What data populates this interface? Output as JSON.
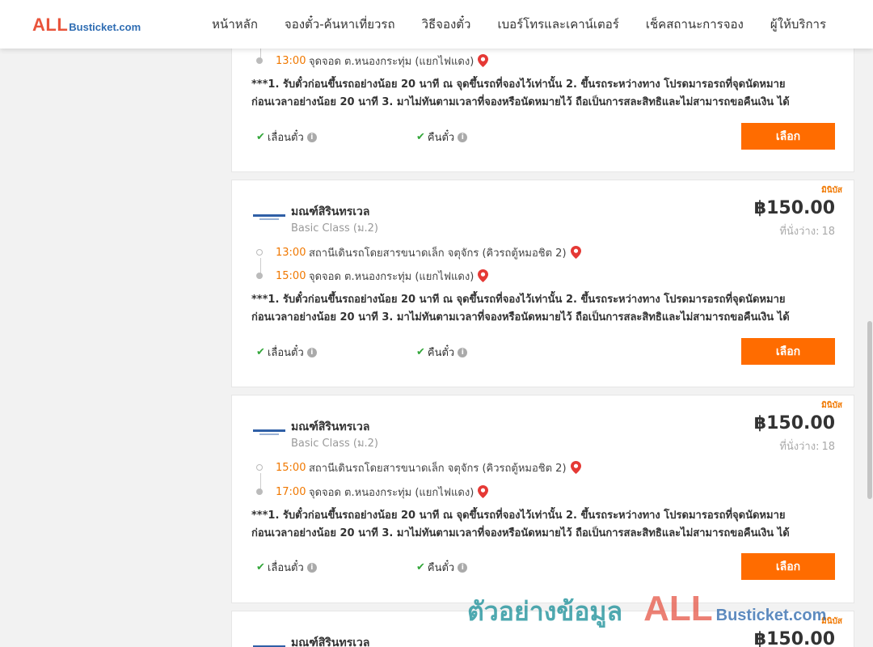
{
  "header": {
    "logo_all": "ALL",
    "logo_rest": "Busticket.com",
    "nav": [
      "หน้าหลัก",
      "จองตั๋ว-ค้นหาเที่ยวรถ",
      "วิธีจองตั๋ว",
      "เบอร์โทรและเคาน์เตอร์",
      "เช็คสถานะการจอง",
      "ผู้ให้บริการ"
    ]
  },
  "cards": [
    {
      "arrive_time": "13:00",
      "arrive_place": "จุดจอด ต.หนองกระทุ่ม (แยกไฟแดง)",
      "note1": "***1. รับตั๋วก่อนขึ้นรถอย่างน้อย 20 นาที ณ จุดขึ้นรถที่จองไว้เท่านั้น 2. ขึ้นรถระหว่างทาง โปรดมารอรถที่จุดนัดหมาย",
      "note2": "ก่อนเวลาอย่างน้อย 20 นาที 3. มาไม่ทันตามเวลาที่จองหรือนัดหมายไว้ ถือเป็นการสละสิทธิและไม่สามารถขอคืนเงิน ได้",
      "feature1": "เลื่อนตั๋ว",
      "feature2": "คืนตั๋ว",
      "button": "เลือก"
    },
    {
      "badge": "มินิบัส",
      "operator": "มณฑ์สิรินทรเวล",
      "class": "Basic Class (ม.2)",
      "price": "฿150.00",
      "seats_label": "ที่นั่งว่าง:",
      "seats": "18",
      "depart_time": "13:00",
      "depart_place": "สถานีเดินรถโดยสารขนาดเล็ก จตุจักร (คิวรถตู้หมอชิต 2)",
      "arrive_time": "15:00",
      "arrive_place": "จุดจอด ต.หนองกระทุ่ม (แยกไฟแดง)",
      "note1": "***1. รับตั๋วก่อนขึ้นรถอย่างน้อย 20 นาที ณ จุดขึ้นรถที่จองไว้เท่านั้น 2. ขึ้นรถระหว่างทาง โปรดมารอรถที่จุดนัดหมาย",
      "note2": "ก่อนเวลาอย่างน้อย 20 นาที 3. มาไม่ทันตามเวลาที่จองหรือนัดหมายไว้ ถือเป็นการสละสิทธิและไม่สามารถขอคืนเงิน ได้",
      "feature1": "เลื่อนตั๋ว",
      "feature2": "คืนตั๋ว",
      "button": "เลือก"
    },
    {
      "badge": "มินิบัส",
      "operator": "มณฑ์สิรินทรเวล",
      "class": "Basic Class (ม.2)",
      "price": "฿150.00",
      "seats_label": "ที่นั่งว่าง:",
      "seats": "18",
      "depart_time": "15:00",
      "depart_place": "สถานีเดินรถโดยสารขนาดเล็ก จตุจักร (คิวรถตู้หมอชิต 2)",
      "arrive_time": "17:00",
      "arrive_place": "จุดจอด ต.หนองกระทุ่ม (แยกไฟแดง)",
      "note1": "***1. รับตั๋วก่อนขึ้นรถอย่างน้อย 20 นาที ณ จุดขึ้นรถที่จองไว้เท่านั้น 2. ขึ้นรถระหว่างทาง โปรดมารอรถที่จุดนัดหมาย",
      "note2": "ก่อนเวลาอย่างน้อย 20 นาที 3. มาไม่ทันตามเวลาที่จองหรือนัดหมายไว้ ถือเป็นการสละสิทธิและไม่สามารถขอคืนเงิน ได้",
      "feature1": "เลื่อนตั๋ว",
      "feature2": "คืนตั๋ว",
      "button": "เลือก"
    },
    {
      "badge": "มินิบัส",
      "operator": "มณฑ์สิรินทรเวล",
      "price": "฿150.00"
    }
  ],
  "watermark": {
    "thai": "ตัวอย่างข้อมูล",
    "all": "ALL",
    "rest": "Busticket.com"
  },
  "colors": {
    "accent": "#ff6c00",
    "time": "#f07800",
    "check": "#33a63a",
    "pin": "#e53935"
  }
}
